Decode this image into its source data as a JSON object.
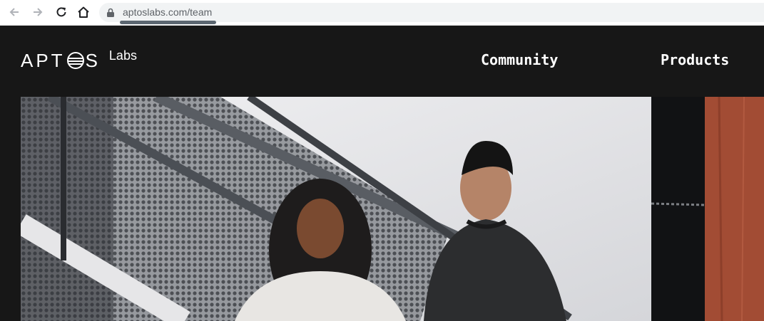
{
  "browser": {
    "url": "aptoslabs.com/team"
  },
  "header": {
    "logo_main": "APT",
    "logo_end": "S",
    "logo_sub": "Labs",
    "nav": [
      {
        "label": "Community"
      },
      {
        "label": "Products"
      }
    ]
  },
  "colors": {
    "background": "#171717",
    "accent_side": "#a24c34"
  }
}
